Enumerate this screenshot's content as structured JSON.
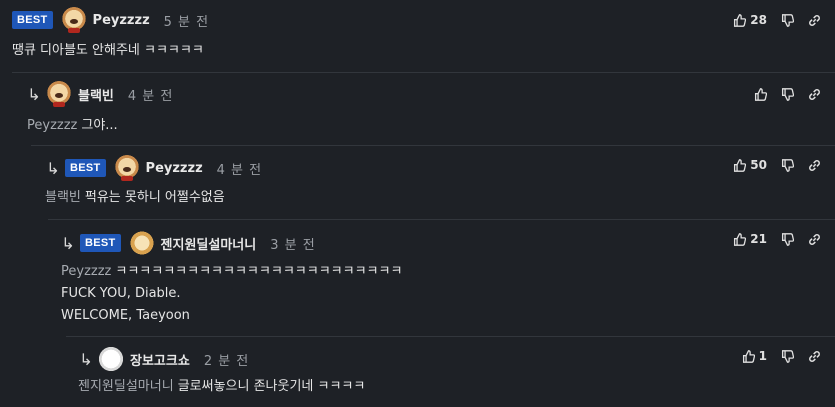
{
  "comments": [
    {
      "best": true,
      "badge": "BEST",
      "author": "Peyzzzz",
      "time": "5 분 전",
      "likes": "28",
      "mention": "",
      "lines": [
        "땡큐 디아블도 안해주네 ㅋㅋㅋㅋㅋ"
      ],
      "avatar": "poodle-with-ribbon"
    },
    {
      "best": false,
      "badge": "",
      "author": "블랙빈",
      "time": "4 분 전",
      "likes": "",
      "mention": "Peyzzzz",
      "lines": [
        "그야..."
      ],
      "avatar": "poodle-with-ribbon"
    },
    {
      "best": true,
      "badge": "BEST",
      "author": "Peyzzzz",
      "time": "4 분 전",
      "likes": "50",
      "mention": "블랙빈",
      "lines": [
        "퍽유는 못하니 어쩔수없음"
      ],
      "avatar": "poodle-with-ribbon"
    },
    {
      "best": true,
      "badge": "BEST",
      "author": "젠지원딜설마너니",
      "time": "3 분 전",
      "likes": "21",
      "mention": "Peyzzzz",
      "lines": [
        "ㅋㅋㅋㅋㅋㅋㅋㅋㅋㅋㅋㅋㅋㅋㅋㅋㅋㅋㅋㅋㅋㅋㅋㅋ",
        "FUCK YOU, Diable.",
        "WELCOME, Taeyoon"
      ],
      "avatar": "shiba"
    },
    {
      "best": false,
      "badge": "",
      "author": "장보고크쇼",
      "time": "2 분 전",
      "likes": "1",
      "mention": "젠지원딜설마너니",
      "lines": [
        "글로써놓으니 존나웃기네 ㅋㅋㅋㅋ"
      ],
      "avatar": "white-dog"
    }
  ],
  "icons": {
    "like": "thumbs-up-icon",
    "dislike": "thumbs-down-icon",
    "link": "link-icon",
    "reply": "reply-arrow-icon"
  },
  "colors": {
    "background": "#1e2126",
    "badge": "#1f57b8",
    "muted": "#9a9ea4",
    "separator": "#32363c"
  }
}
